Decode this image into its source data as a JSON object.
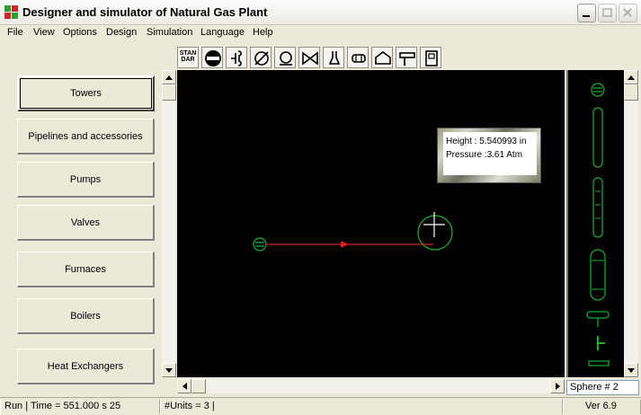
{
  "window": {
    "title": "Designer and simulator of Natural Gas Plant"
  },
  "menu": [
    {
      "label": "File"
    },
    {
      "label": "View"
    },
    {
      "label": "Options"
    },
    {
      "label": "Design"
    },
    {
      "label": "Simulation"
    },
    {
      "label": "Language"
    },
    {
      "label": "Help"
    }
  ],
  "toolbar": {
    "tools": [
      {
        "icon": "standard-icon",
        "label": "STAN DAR"
      },
      {
        "icon": "sphere-selector-icon"
      },
      {
        "icon": "connector-icon"
      },
      {
        "icon": "diameter-icon"
      },
      {
        "icon": "pump-icon"
      },
      {
        "icon": "valve-icon"
      },
      {
        "icon": "flask-icon"
      },
      {
        "icon": "tank-icon"
      },
      {
        "icon": "house-icon"
      },
      {
        "icon": "hammer-icon"
      },
      {
        "icon": "panel-icon"
      }
    ]
  },
  "categories": [
    {
      "label": "Towers",
      "selected": true
    },
    {
      "label": "Pipelines and accessories"
    },
    {
      "label": "Pumps"
    },
    {
      "label": "Valves"
    },
    {
      "label": "Furnaces"
    },
    {
      "label": "Boilers"
    },
    {
      "label": "Heat Exchangers"
    }
  ],
  "canvas": {
    "line_color": "#e01c24",
    "symbol_color": "#18b02c",
    "tooltip": {
      "height_text": "Height : 5.540993 in",
      "pressure_text": "Pressure :3.61 Atm"
    }
  },
  "palette": {
    "items": [
      {
        "icon": "sphere-small-icon"
      },
      {
        "icon": "tall-column-icon"
      },
      {
        "icon": "tray-column-icon"
      },
      {
        "icon": "vessel-icon"
      },
      {
        "icon": "tee-fitting-icon"
      },
      {
        "icon": "pipe-fitting-icon"
      }
    ]
  },
  "selected_unit": "Sphere # 2",
  "status": {
    "run": "Run | Time = 551.000 s 25",
    "units": "#Units = 3  |",
    "version": "Ver 6.9"
  }
}
